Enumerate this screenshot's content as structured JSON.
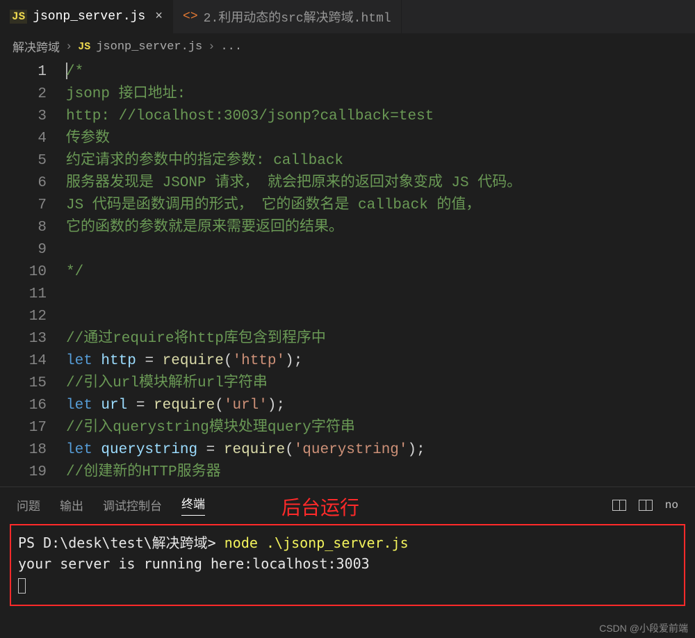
{
  "tabs": [
    {
      "icon": "js",
      "label": "jsonp_server.js",
      "active": true,
      "closeable": true
    },
    {
      "icon": "html",
      "label": "2.利用动态的src解决跨域.html",
      "active": false,
      "closeable": false
    }
  ],
  "breadcrumb": {
    "folder": "解决跨域",
    "fileIcon": "js",
    "file": "jsonp_server.js",
    "tail": "..."
  },
  "code": {
    "lines": [
      {
        "n": 1,
        "segs": [
          {
            "cls": "comment",
            "t": "/*"
          }
        ],
        "current": true
      },
      {
        "n": 2,
        "segs": [
          {
            "cls": "comment",
            "t": "jsonp 接口地址:"
          }
        ]
      },
      {
        "n": 3,
        "segs": [
          {
            "cls": "comment",
            "t": "http: //localhost:3003/jsonp?callback=test"
          }
        ]
      },
      {
        "n": 4,
        "segs": [
          {
            "cls": "comment",
            "t": "传参数"
          }
        ]
      },
      {
        "n": 5,
        "segs": [
          {
            "cls": "comment",
            "t": "约定请求的参数中的指定参数: callback"
          }
        ]
      },
      {
        "n": 6,
        "segs": [
          {
            "cls": "comment",
            "t": "服务器发现是 JSONP 请求， 就会把原来的返回对象变成 JS 代码。"
          }
        ]
      },
      {
        "n": 7,
        "segs": [
          {
            "cls": "comment",
            "t": "JS 代码是函数调用的形式， 它的函数名是 callback 的值，"
          }
        ]
      },
      {
        "n": 8,
        "segs": [
          {
            "cls": "comment",
            "t": "它的函数的参数就是原来需要返回的结果。"
          }
        ]
      },
      {
        "n": 9,
        "segs": []
      },
      {
        "n": 10,
        "segs": [
          {
            "cls": "comment",
            "t": "*/"
          }
        ]
      },
      {
        "n": 11,
        "segs": []
      },
      {
        "n": 12,
        "segs": []
      },
      {
        "n": 13,
        "segs": [
          {
            "cls": "comment",
            "t": "//通过require将http库包含到程序中"
          }
        ]
      },
      {
        "n": 14,
        "segs": [
          {
            "cls": "kw",
            "t": "let"
          },
          {
            "cls": "punc",
            "t": " "
          },
          {
            "cls": "var",
            "t": "http"
          },
          {
            "cls": "punc",
            "t": " = "
          },
          {
            "cls": "fn",
            "t": "require"
          },
          {
            "cls": "punc",
            "t": "("
          },
          {
            "cls": "str",
            "t": "'http'"
          },
          {
            "cls": "punc",
            "t": ");"
          }
        ]
      },
      {
        "n": 15,
        "segs": [
          {
            "cls": "comment",
            "t": "//引入url模块解析url字符串"
          }
        ]
      },
      {
        "n": 16,
        "segs": [
          {
            "cls": "kw",
            "t": "let"
          },
          {
            "cls": "punc",
            "t": " "
          },
          {
            "cls": "var",
            "t": "url"
          },
          {
            "cls": "punc",
            "t": " = "
          },
          {
            "cls": "fn",
            "t": "require"
          },
          {
            "cls": "punc",
            "t": "("
          },
          {
            "cls": "str",
            "t": "'url'"
          },
          {
            "cls": "punc",
            "t": ");"
          }
        ]
      },
      {
        "n": 17,
        "segs": [
          {
            "cls": "comment",
            "t": "//引入querystring模块处理query字符串"
          }
        ]
      },
      {
        "n": 18,
        "segs": [
          {
            "cls": "kw",
            "t": "let"
          },
          {
            "cls": "punc",
            "t": " "
          },
          {
            "cls": "var",
            "t": "querystring"
          },
          {
            "cls": "punc",
            "t": " = "
          },
          {
            "cls": "fn",
            "t": "require"
          },
          {
            "cls": "punc",
            "t": "("
          },
          {
            "cls": "str",
            "t": "'querystring'"
          },
          {
            "cls": "punc",
            "t": ");"
          }
        ]
      },
      {
        "n": 19,
        "segs": [
          {
            "cls": "comment",
            "t": "//创建新的HTTP服务器"
          }
        ]
      }
    ]
  },
  "panel": {
    "tabs": [
      "问题",
      "输出",
      "调试控制台",
      "终端"
    ],
    "activeTab": "终端",
    "rightLabel": "no",
    "annotation": "后台运行"
  },
  "terminal": {
    "prompt": "PS D:\\desk\\test\\解决跨域> ",
    "cmd": "node .\\jsonp_server.js",
    "output": "your server is running here:localhost:3003"
  },
  "watermark": "CSDN @小段爱前端"
}
